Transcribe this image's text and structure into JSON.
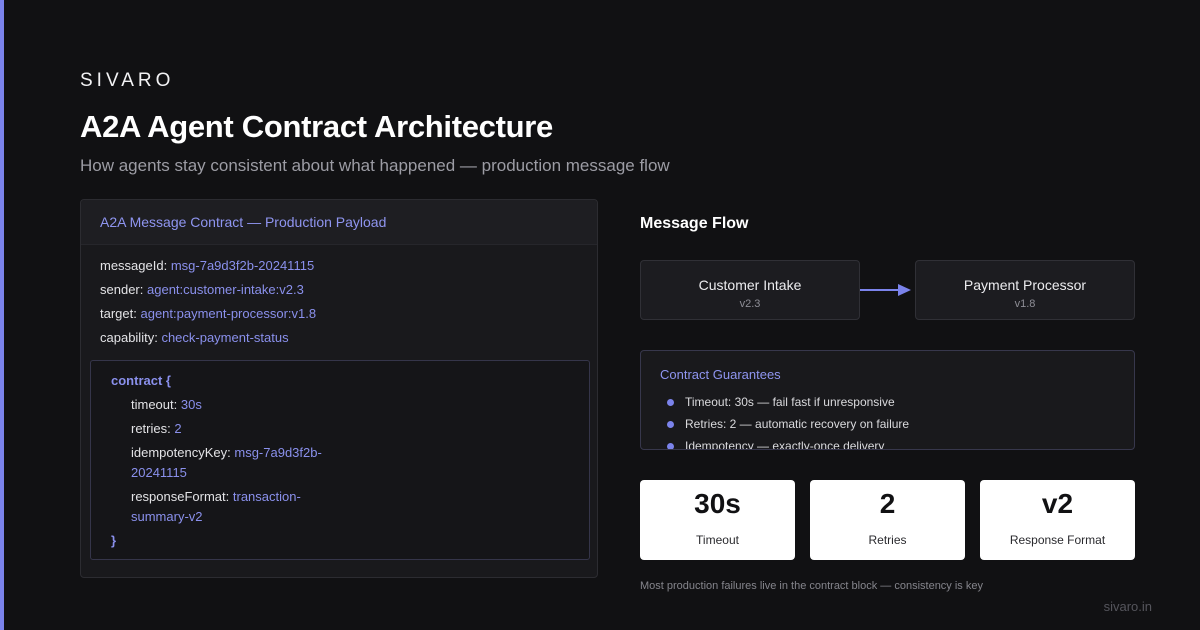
{
  "brand": "SIVARO",
  "title": "A2A Agent Contract Architecture",
  "subtitle": "How agents stay consistent about what happened — production message flow",
  "payload": {
    "header": "A2A Message Contract — Production Payload",
    "fields": [
      {
        "key": "messageId:",
        "value": "msg-7a9d3f2b-20241115"
      },
      {
        "key": "sender:",
        "value": "agent:customer-intake:v2.3"
      },
      {
        "key": "target:",
        "value": "agent:payment-processor:v1.8"
      },
      {
        "key": "capability:",
        "value": "check-payment-status"
      }
    ],
    "contract": {
      "open": "contract {",
      "close": "}",
      "fields": [
        {
          "key": "timeout:",
          "value": "30s"
        },
        {
          "key": "retries:",
          "value": "2"
        },
        {
          "key": "idempotencyKey:",
          "value": "msg-7a9d3f2b-20241115"
        },
        {
          "key": "responseFormat:",
          "value": "transaction-summary-v2"
        }
      ]
    }
  },
  "flow": {
    "title": "Message Flow",
    "nodes": [
      {
        "name": "Customer Intake",
        "version": "v2.3"
      },
      {
        "name": "Payment Processor",
        "version": "v1.8"
      }
    ],
    "arrow_color": "#7b83eb"
  },
  "guarantees": {
    "title": "Contract Guarantees",
    "items": [
      "Timeout: 30s — fail fast if unresponsive",
      "Retries: 2 — automatic recovery on failure",
      "Idempotency — exactly-once delivery"
    ]
  },
  "stats": [
    {
      "value": "30s",
      "label": "Timeout"
    },
    {
      "value": "2",
      "label": "Retries"
    },
    {
      "value": "v2",
      "label": "Response Format"
    }
  ],
  "footnote": "Most production failures live in the contract block — consistency is key",
  "site": "sivaro.in",
  "colors": {
    "accent": "#7b83eb",
    "background": "#111113",
    "card": "#19191c"
  }
}
